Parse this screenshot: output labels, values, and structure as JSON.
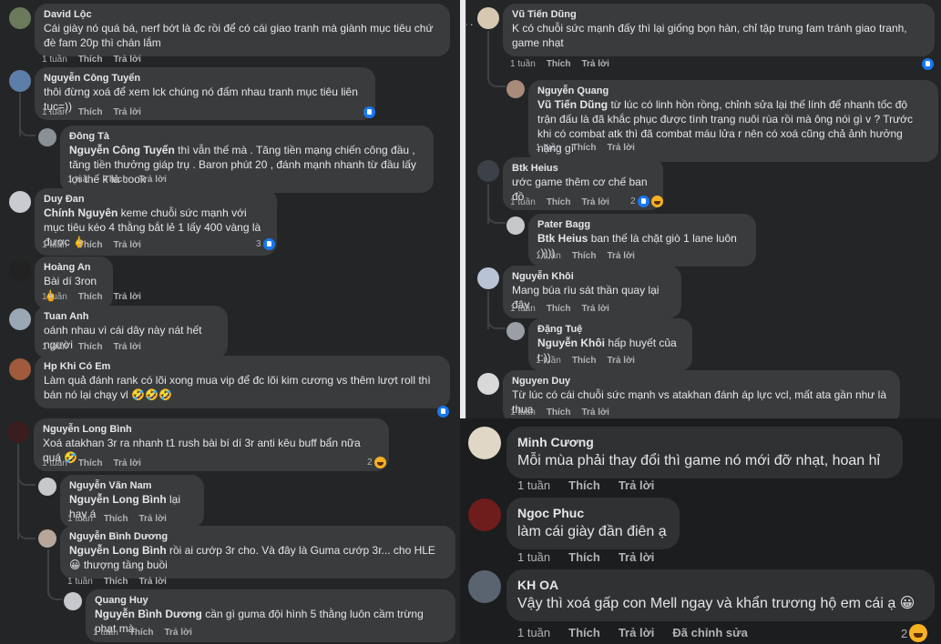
{
  "labels": {
    "like": "Thích",
    "reply": "Trả lời",
    "edited": "Đã chỉnh sửa",
    "more": "···"
  },
  "left": [
    {
      "name": "David Lộc",
      "text": "Cái giày nó quá bá, nerf bớt là đc rồi để có cái giao tranh mà giành mục tiêu chứ đè fam 20p thì chán lắm",
      "time": "1 tuần"
    },
    {
      "name": "Nguyễn Công Tuyển",
      "text": "thôi đừng xoá để xem lck chúng nó đấm nhau tranh mục tiêu liên tục=))",
      "time": "1 tuần",
      "reacts": ""
    },
    {
      "name": "Đông Tà",
      "mention": "Nguyễn Công Tuyển",
      "text": " thì vẫn thế mà . Tăng tiền mạng chiến công đầu , tăng tiền thưởng giáp trụ . Baron phút 20 , đánh mạnh nhanh từ đầu lấy lợi thế k là cook",
      "time": "1 tuần"
    },
    {
      "name": "Duy Đan",
      "mention": "Chính Nguyên",
      "text": " keme chuỗi sức mạnh với mục tiêu kéo 4 thằng bắt lẻ 1 lấy 400 vàng là được 🖕",
      "time": "1 tuần",
      "reacts": "3"
    },
    {
      "name": "Hoàng An",
      "text": "Bài dí 3ron 🖕",
      "time": "1 tuần"
    },
    {
      "name": "Tuan Anh",
      "text": "oánh nhau vì cái dây này nát hết người",
      "time": "1 tuần"
    },
    {
      "name": "Hp Khi Có Em",
      "text": "Làm quả đánh rank có lõi xong mua vip để đc lõi kim cương vs thêm lượt roll thì bán nó lại chạy vl 🤣🤣🤣",
      "time": "1 tuần"
    },
    {
      "name": "Nguyễn Long Bình",
      "text": "Xoá atakhan 3r ra nhanh t1 rush bài bí dí 3r anti kêu buff bẩn nữa quá 🤣",
      "time": "1 tuần",
      "reacts": "2"
    },
    {
      "name": "Nguyễn Văn Nam",
      "mention": "Nguyễn Long Bình",
      "text": " lại hay á",
      "time": "1 tuần"
    },
    {
      "name": "Nguyễn Bình Dương",
      "mention": "Nguyễn Long Bình",
      "text": " rồi ai cướp 3r cho. Và đây là Guma cướp 3r... cho HLE 😀 thượng tầng buồi",
      "time": "1 tuần"
    },
    {
      "name": "Quang Huy",
      "mention": "Nguyễn Bình Dương",
      "text": " cần gì guma đội hình 5 thằng luôn cầm trừng phạt mà",
      "time": "1 tuần"
    }
  ],
  "right": [
    {
      "name": "Vũ Tiến Dũng",
      "text": "K có chuỗi sức mạnh đấy thì lại giống bọn hàn, chỉ tập trung fam tránh giao tranh, game nhạt",
      "time": "1 tuần"
    },
    {
      "name": "Nguyễn Quang",
      "mention": "Vũ Tiến Dũng",
      "text": " từ lúc có linh hồn rồng, chỉnh sửa lại thế lính để nhanh tốc độ trận đấu là đã khắc phục được tình trạng nuôi rùa rồi mà ông nói gì v ? Trước khi có combat atk thì đã combat máu lửa r nên có xoá cũng chả ảnh hưởng nặng gì",
      "time": "1 tuần"
    },
    {
      "name": "Btk Heius",
      "text": "ước game thêm cơ chế ban đồ",
      "time": "1 tuần",
      "reacts": "2"
    },
    {
      "name": "Pater Bagg",
      "mention": "Btk Heius",
      "text": " ban thế là chặt giò 1 lane luôn :))))",
      "time": "1 tuần"
    },
    {
      "name": "Nguyễn Khôi",
      "text": "Mang búa rìu sát thần quay lại đây",
      "time": "1 tuần"
    },
    {
      "name": "Đặng Tuệ",
      "mention": "Nguyễn Khôi",
      "text": " hấp huyết của t:))",
      "time": "1 tuần"
    },
    {
      "name": "Nguyen Duy",
      "text": "Từ lúc có cái chuỗi sức mạnh vs atakhan đánh áp lực vcl, mất ata gần như là thua",
      "time": "1 tuần"
    }
  ],
  "bottom": [
    {
      "name": "Minh Cương",
      "text": "Mỗi mùa phải thay đổi thì game nó mới đỡ nhạt, hoan hỉ",
      "time": "1 tuần"
    },
    {
      "name": "Ngoc Phuc",
      "text": "làm cái giày đần điên ạ",
      "time": "1 tuần"
    },
    {
      "name": "KH OA",
      "text": "Vậy thì xoá gấp con Mell ngay và khẩn trương hộ em cái ạ 😀",
      "time": "1 tuần",
      "reacts": "2"
    }
  ],
  "colors": {
    "bg": "#242526",
    "bubble": "#3a3b3c",
    "text": "#e4e6eb",
    "muted": "#b0b3b8",
    "like": "#1877f2",
    "haha": "#f7b125"
  }
}
